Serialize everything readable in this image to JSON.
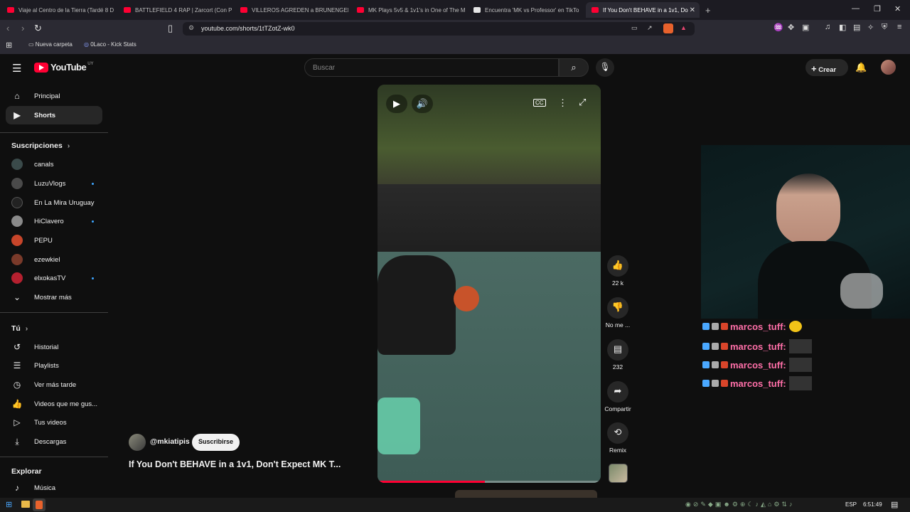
{
  "browser": {
    "tabs": [
      {
        "label": "Viaje al Centro de la Tierra (Tardé 8 D",
        "active": false
      },
      {
        "label": "BATTLEFIELD 4 RAP | Zarcort (Con Pit",
        "active": false
      },
      {
        "label": "VILLEROS AGREDEN a BRUNENGER y",
        "active": false
      },
      {
        "label": "MK Plays 5v5 & 1v1's in One of The M",
        "active": false
      },
      {
        "label": "Encuentra 'MK vs Professor' en TikTo",
        "active": false
      },
      {
        "label": "If You Don't BEHAVE in a 1v1, Do",
        "active": true
      }
    ],
    "new_tab": "+",
    "url": "youtube.com/shorts/1tTZotZ-wk0",
    "bookmarks": [
      "Nueva carpeta",
      "0Laco - Kick Stats"
    ]
  },
  "youtube": {
    "logo_text": "YouTube",
    "region": "UY",
    "search_placeholder": "Buscar",
    "create_label": "Crear",
    "sidebar": {
      "main": [
        {
          "label": "Principal",
          "icon": "home-icon"
        },
        {
          "label": "Shorts",
          "icon": "shorts-icon"
        }
      ],
      "subscriptions_title": "Suscripciones",
      "subscriptions": [
        {
          "label": "canals",
          "dot": false,
          "color": "#3a4a4a"
        },
        {
          "label": "LuzuVlogs",
          "dot": true,
          "color": "#4a4a4a"
        },
        {
          "label": "En La Mira Uruguay",
          "dot": false,
          "color": "#222222"
        },
        {
          "label": "HiClavero",
          "dot": true,
          "color": "#8a8a8a"
        },
        {
          "label": "PEPU",
          "dot": false,
          "color": "#c7452a"
        },
        {
          "label": "ezewkiel",
          "dot": false,
          "color": "#7a3a2a"
        },
        {
          "label": "elxokasTV",
          "dot": true,
          "color": "#b5202f"
        }
      ],
      "show_more": "Mostrar más",
      "you_title": "Tú",
      "you": [
        {
          "label": "Historial",
          "icon": "history-icon"
        },
        {
          "label": "Playlists",
          "icon": "playlists-icon"
        },
        {
          "label": "Ver más tarde",
          "icon": "watch-later-icon"
        },
        {
          "label": "Videos que me gus...",
          "icon": "liked-videos-icon"
        },
        {
          "label": "Tus videos",
          "icon": "your-videos-icon"
        },
        {
          "label": "Descargas",
          "icon": "downloads-icon"
        }
      ],
      "explore_title": "Explorar",
      "explore": [
        {
          "label": "Música",
          "icon": "music-icon"
        }
      ]
    },
    "short": {
      "channel": "@mkiatipis",
      "subscribe_label": "Suscribirse",
      "title": "If You Don't BEHAVE in a 1v1, Don't Expect MK T...",
      "progress": 0.48,
      "actions": [
        {
          "label": "22 k",
          "icon": "like-icon"
        },
        {
          "label": "No me ...",
          "icon": "dislike-icon"
        },
        {
          "label": "232",
          "icon": "comment-icon"
        },
        {
          "label": "Compartir",
          "icon": "share-icon"
        },
        {
          "label": "Remix",
          "icon": "remix-icon"
        }
      ]
    }
  },
  "overlay": {
    "chat": [
      {
        "user": "marcos_tuff:",
        "emote": "emoji"
      },
      {
        "user": "marcos_tuff:",
        "emote": "image"
      },
      {
        "user": "marcos_tuff:",
        "emote": "image"
      },
      {
        "user": "marcos_tuff:",
        "emote": "image"
      }
    ]
  },
  "taskbar": {
    "language": "ESP",
    "time": "6:51:49"
  },
  "colors": {
    "youtube_red": "#ff0033",
    "chat_name": "#ff6fa8",
    "link_blue": "#3ea6ff"
  }
}
